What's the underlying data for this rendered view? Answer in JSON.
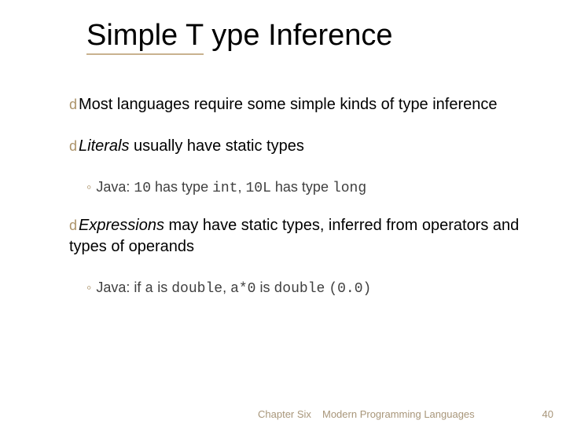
{
  "title_a": "Simple T",
  "title_b": "ype Inference",
  "bullets": {
    "b1": {
      "marker": "d",
      "t1": "Most languages require some simple kinds of type inference"
    },
    "b2": {
      "marker": "d",
      "word": "Literals",
      "rest": " usually have static types"
    },
    "s2": {
      "marker": "◦",
      "t1": "Java: ",
      "c1": "10",
      "t2": " has type ",
      "c2": "int",
      "t3": ", ",
      "c3": "10L",
      "t4": " has type ",
      "c4": "long"
    },
    "b3": {
      "marker": "d",
      "word": "Expressions",
      "rest": " may have static types, inferred from operators and types of operands"
    },
    "s3": {
      "marker": "◦",
      "t1": "Java: if ",
      "c1": "a",
      "t2": " is ",
      "c2": "double",
      "t3": ", ",
      "c3": "a*0",
      "t4": " is ",
      "c4": "double",
      "t5": " ",
      "c5": "(0.0)"
    }
  },
  "footer": {
    "chapter": "Chapter Six",
    "book": "Modern Programming Languages",
    "page": "40"
  }
}
